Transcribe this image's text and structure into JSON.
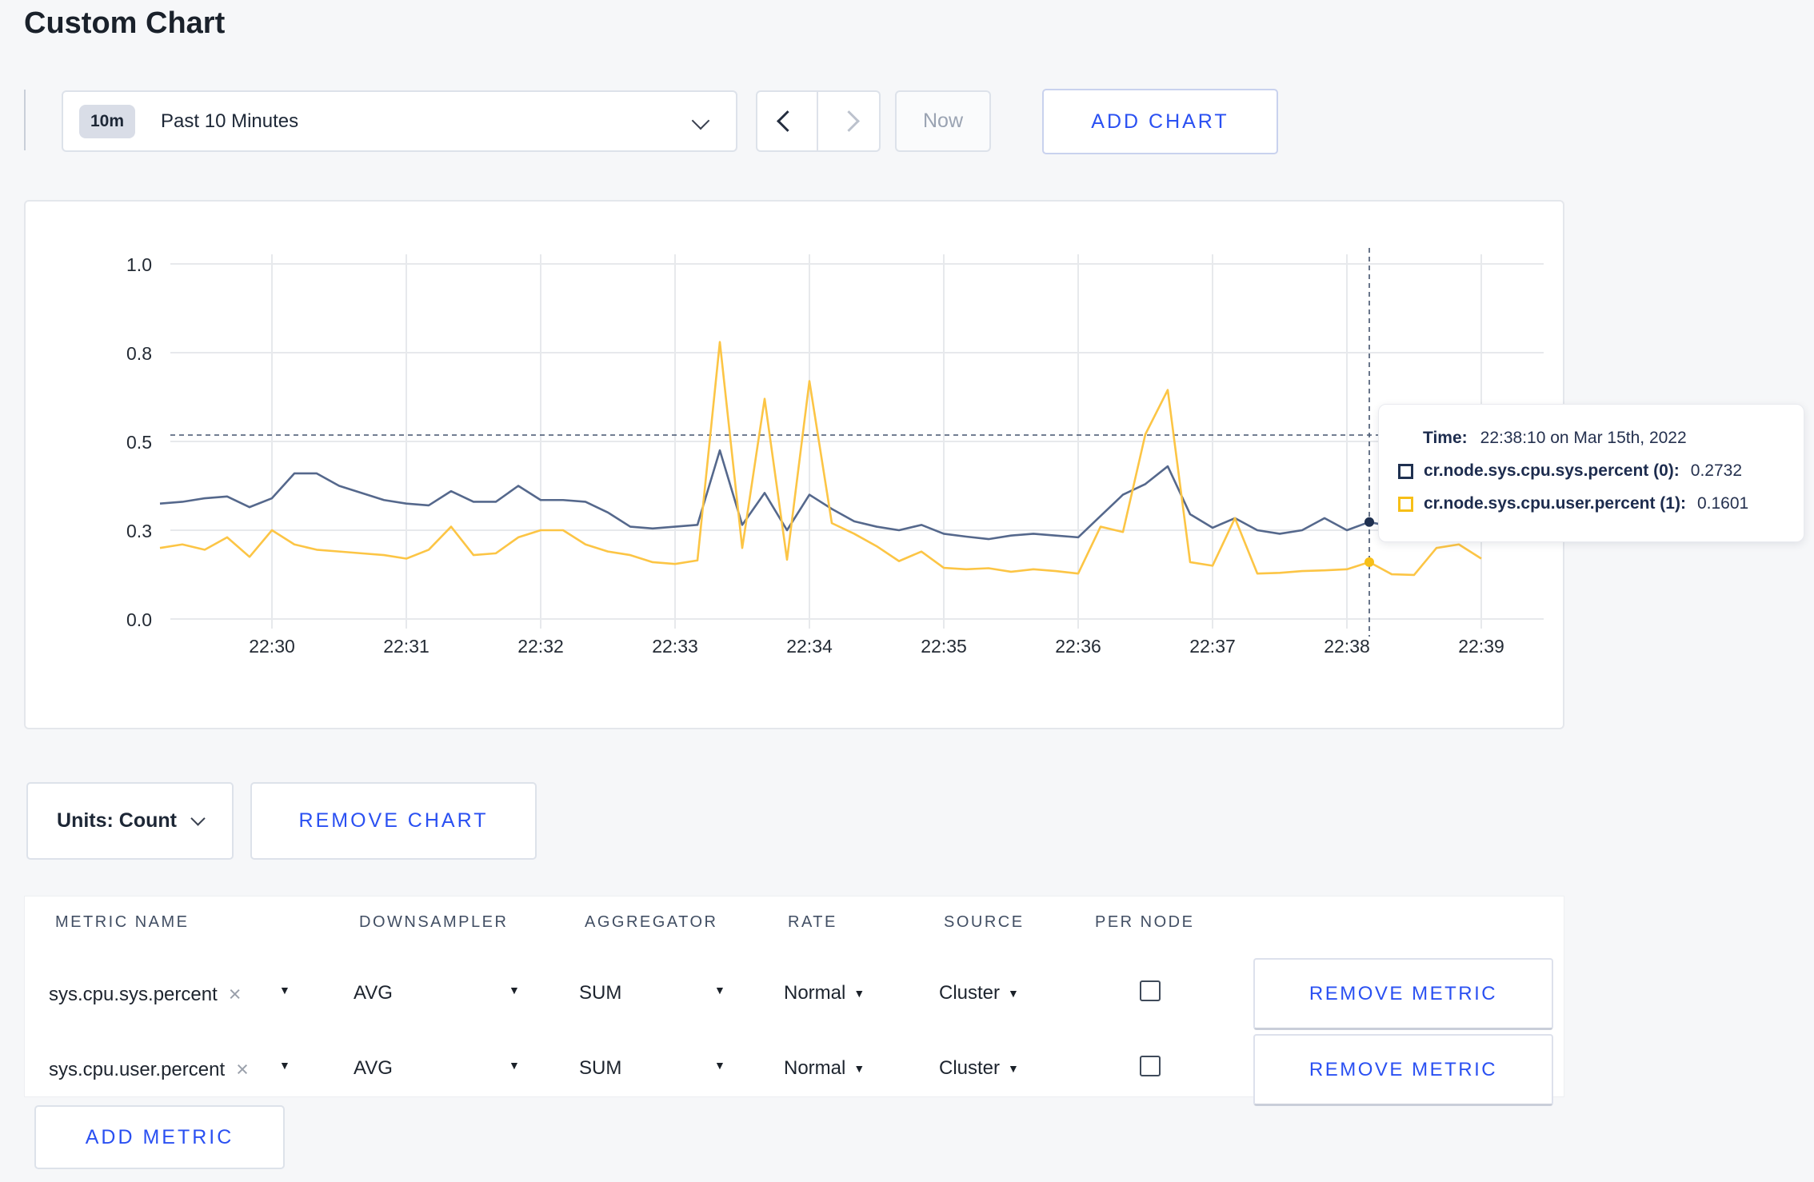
{
  "page": {
    "title": "Custom Chart",
    "background_color": "#f6f7f9",
    "accent_color": "#2a50f2"
  },
  "toolbar": {
    "time_badge": "10m",
    "time_label": "Past 10 Minutes",
    "now_label": "Now",
    "add_chart_label": "ADD CHART"
  },
  "tooltip": {
    "time_label": "Time:",
    "time_value": "22:38:10 on Mar 15th, 2022",
    "rows": [
      {
        "label": "cr.node.sys.cpu.sys.percent (0):",
        "value": "0.2732",
        "swatch_color": "#1f3050"
      },
      {
        "label": "cr.node.sys.cpu.user.percent (1):",
        "value": "0.1601",
        "swatch_color": "#f7bf17"
      }
    ]
  },
  "chart_data": {
    "type": "line",
    "title": "",
    "xlabel": "",
    "ylabel": "",
    "ylim": [
      0,
      1
    ],
    "grid": true,
    "legend_position": "tooltip",
    "start_time": "22:29:10",
    "end_time": "22:39:00",
    "interval_sec": 10,
    "x_ticks": [
      "22:30",
      "22:31",
      "22:32",
      "22:33",
      "22:34",
      "22:35",
      "22:36",
      "22:37",
      "22:38",
      "22:39"
    ],
    "y_ticks": [
      {
        "label": "1.0",
        "pos": 1.0
      },
      {
        "label": "0.8",
        "pos": 0.75
      },
      {
        "label": "0.5",
        "pos": 0.5
      },
      {
        "label": "0.3",
        "pos": 0.25
      },
      {
        "label": "0.0",
        "pos": 0.0
      }
    ],
    "crosshair_index": 54,
    "crosshair_time": "22:38:10",
    "h_guide_value": 0.518,
    "grid_color": "#e7e9ec",
    "crosshair_color": "#44546e",
    "axis_label_color": "#242b35",
    "series": [
      {
        "name": "cr.node.sys.cpu.sys.percent (0)",
        "color": "#55688c",
        "swatch_color": "#1f3050",
        "values": [
          0.325,
          0.33,
          0.34,
          0.345,
          0.315,
          0.34,
          0.41,
          0.41,
          0.375,
          0.355,
          0.335,
          0.325,
          0.32,
          0.36,
          0.33,
          0.33,
          0.375,
          0.335,
          0.335,
          0.33,
          0.3,
          0.26,
          0.255,
          0.26,
          0.265,
          0.475,
          0.265,
          0.355,
          0.25,
          0.35,
          0.31,
          0.275,
          0.26,
          0.25,
          0.265,
          0.24,
          0.232,
          0.225,
          0.235,
          0.24,
          0.235,
          0.23,
          0.29,
          0.35,
          0.38,
          0.43,
          0.295,
          0.257,
          0.284,
          0.25,
          0.24,
          0.25,
          0.284,
          0.25,
          0.2732,
          0.26,
          0.27,
          0.28,
          0.27,
          0.28
        ]
      },
      {
        "name": "cr.node.sys.cpu.user.percent (1)",
        "color": "#fcc545",
        "swatch_color": "#f7bf17",
        "values": [
          0.2,
          0.21,
          0.195,
          0.23,
          0.175,
          0.25,
          0.21,
          0.195,
          0.19,
          0.185,
          0.18,
          0.17,
          0.195,
          0.26,
          0.18,
          0.185,
          0.23,
          0.25,
          0.25,
          0.21,
          0.19,
          0.18,
          0.16,
          0.155,
          0.165,
          0.78,
          0.2,
          0.62,
          0.167,
          0.67,
          0.27,
          0.24,
          0.205,
          0.163,
          0.19,
          0.144,
          0.14,
          0.143,
          0.133,
          0.14,
          0.135,
          0.128,
          0.26,
          0.245,
          0.52,
          0.645,
          0.16,
          0.15,
          0.284,
          0.128,
          0.13,
          0.135,
          0.137,
          0.14,
          0.1601,
          0.126,
          0.124,
          0.2,
          0.21,
          0.17
        ]
      }
    ]
  },
  "controls": {
    "units_label": "Units: Count",
    "remove_chart_label": "REMOVE CHART",
    "add_metric_label": "ADD METRIC"
  },
  "table": {
    "headers": [
      "METRIC NAME",
      "DOWNSAMPLER",
      "AGGREGATOR",
      "RATE",
      "SOURCE",
      "PER NODE"
    ],
    "rows": [
      {
        "name": "sys.cpu.sys.percent",
        "downsampler": "AVG",
        "aggregator": "SUM",
        "rate": "Normal",
        "source": "Cluster",
        "per_node_checked": false,
        "remove_label": "REMOVE METRIC"
      },
      {
        "name": "sys.cpu.user.percent",
        "downsampler": "AVG",
        "aggregator": "SUM",
        "rate": "Normal",
        "source": "Cluster",
        "per_node_checked": false,
        "remove_label": "REMOVE METRIC"
      }
    ]
  }
}
